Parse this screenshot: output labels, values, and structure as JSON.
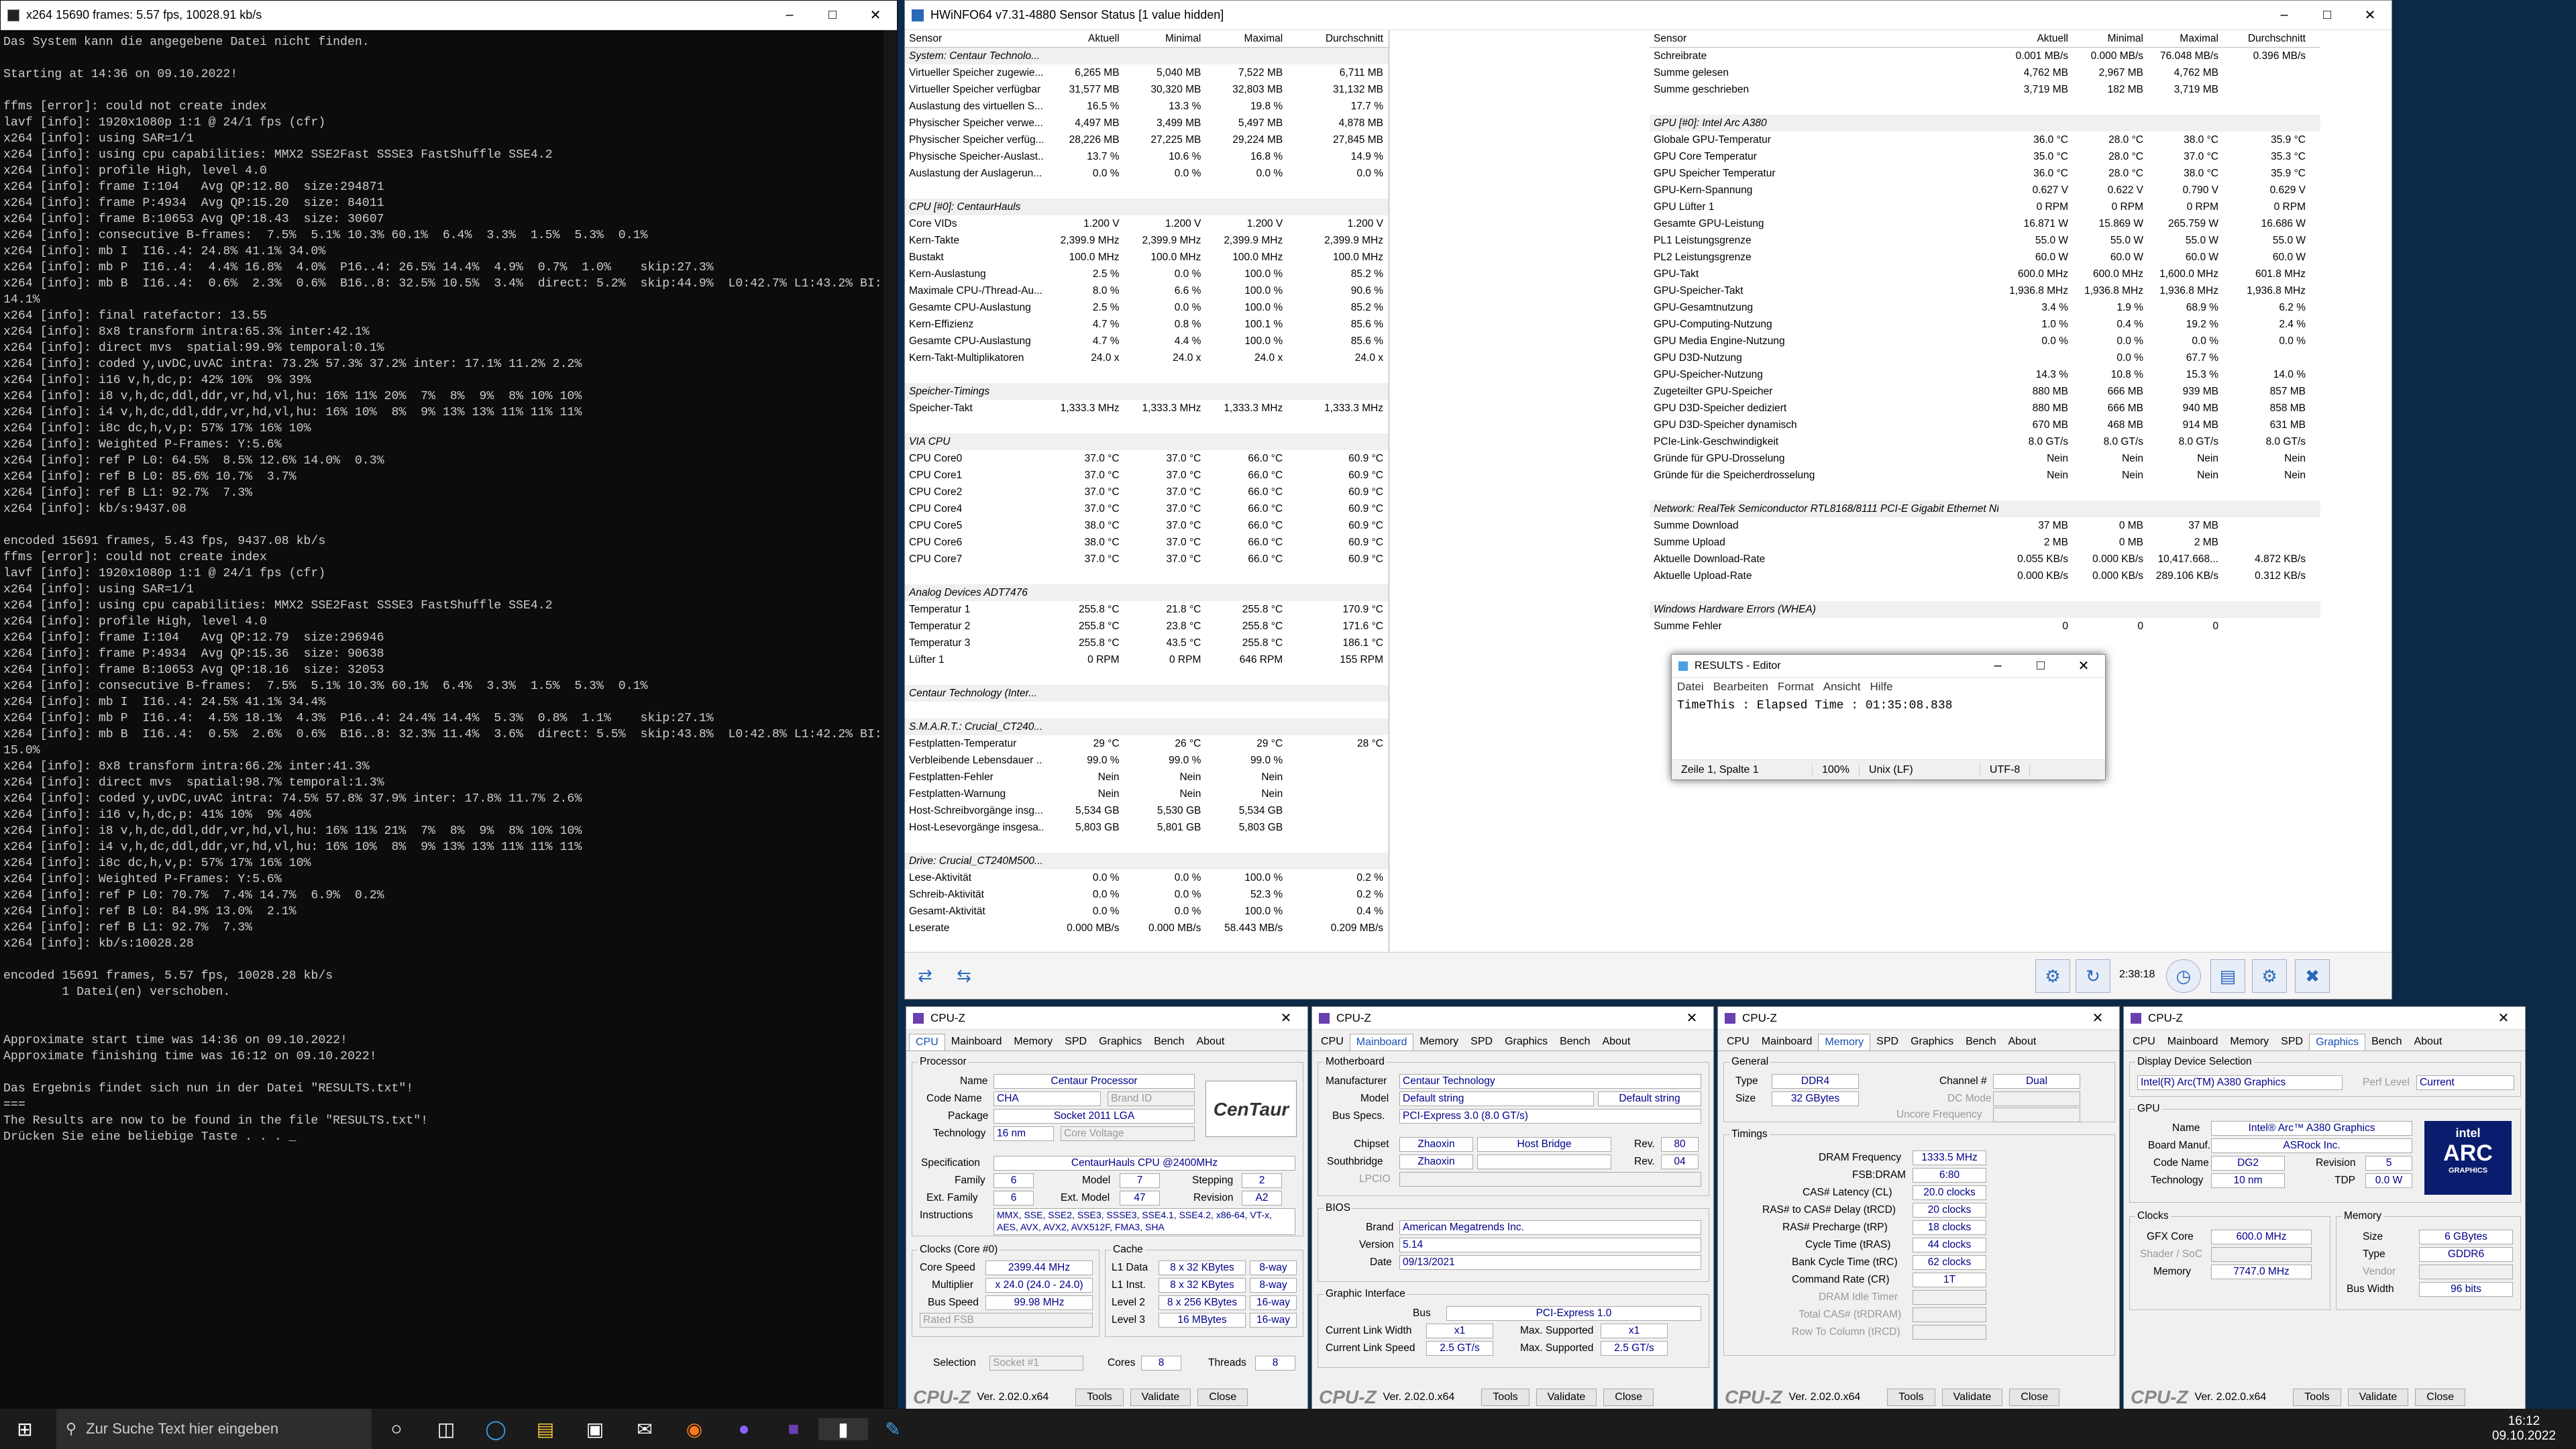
{
  "console": {
    "title": "x264 15690 frames: 5.57 fps, 10028.91 kb/s",
    "lines": [
      "Das System kann die angegebene Datei nicht finden.",
      "",
      "Starting at 14:36 on 09.10.2022!",
      "",
      "ffms [error]: could not create index",
      "lavf [info]: 1920x1080p 1:1 @ 24/1 fps (cfr)",
      "x264 [info]: using SAR=1/1",
      "x264 [info]: using cpu capabilities: MMX2 SSE2Fast SSSE3 FastShuffle SSE4.2",
      "x264 [info]: profile High, level 4.0",
      "x264 [info]: frame I:104   Avg QP:12.80  size:294871",
      "x264 [info]: frame P:4934  Avg QP:15.20  size: 84011",
      "x264 [info]: frame B:10653 Avg QP:18.43  size: 30607",
      "x264 [info]: consecutive B-frames:  7.5%  5.1% 10.3% 60.1%  6.4%  3.3%  1.5%  5.3%  0.1%",
      "x264 [info]: mb I  I16..4: 24.8% 41.1% 34.0%",
      "x264 [info]: mb P  I16..4:  4.4% 16.8%  4.0%  P16..4: 26.5% 14.4%  4.9%  0.7%  1.0%    skip:27.3%",
      "x264 [info]: mb B  I16..4:  0.6%  2.3%  0.6%  B16..8: 32.5% 10.5%  3.4%  direct: 5.2%  skip:44.9%  L0:42.7% L1:43.2% BI:",
      "14.1%",
      "x264 [info]: final ratefactor: 13.55",
      "x264 [info]: 8x8 transform intra:65.3% inter:42.1%",
      "x264 [info]: direct mvs  spatial:99.9% temporal:0.1%",
      "x264 [info]: coded y,uvDC,uvAC intra: 73.2% 57.3% 37.2% inter: 17.1% 11.2% 2.2%",
      "x264 [info]: i16 v,h,dc,p: 42% 10%  9% 39%",
      "x264 [info]: i8 v,h,dc,ddl,ddr,vr,hd,vl,hu: 16% 11% 20%  7%  8%  9%  8% 10% 10%",
      "x264 [info]: i4 v,h,dc,ddl,ddr,vr,hd,vl,hu: 16% 10%  8%  9% 13% 13% 11% 11% 11%",
      "x264 [info]: i8c dc,h,v,p: 57% 17% 16% 10%",
      "x264 [info]: Weighted P-Frames: Y:5.6%",
      "x264 [info]: ref P L0: 64.5%  8.5% 12.6% 14.0%  0.3%",
      "x264 [info]: ref B L0: 85.6% 10.7%  3.7%",
      "x264 [info]: ref B L1: 92.7%  7.3%",
      "x264 [info]: kb/s:9437.08",
      "",
      "encoded 15691 frames, 5.43 fps, 9437.08 kb/s",
      "ffms [error]: could not create index",
      "lavf [info]: 1920x1080p 1:1 @ 24/1 fps (cfr)",
      "x264 [info]: using SAR=1/1",
      "x264 [info]: using cpu capabilities: MMX2 SSE2Fast SSSE3 FastShuffle SSE4.2",
      "x264 [info]: profile High, level 4.0",
      "x264 [info]: frame I:104   Avg QP:12.79  size:296946",
      "x264 [info]: frame P:4934  Avg QP:15.36  size: 90638",
      "x264 [info]: frame B:10653 Avg QP:18.16  size: 32053",
      "x264 [info]: consecutive B-frames:  7.5%  5.1% 10.3% 60.1%  6.4%  3.3%  1.5%  5.3%  0.1%",
      "x264 [info]: mb I  I16..4: 24.5% 41.1% 34.4%",
      "x264 [info]: mb P  I16..4:  4.5% 18.1%  4.3%  P16..4: 24.4% 14.4%  5.3%  0.8%  1.1%    skip:27.1%",
      "x264 [info]: mb B  I16..4:  0.5%  2.6%  0.6%  B16..8: 32.3% 11.4%  3.6%  direct: 5.5%  skip:43.8%  L0:42.8% L1:42.2% BI:",
      "15.0%",
      "x264 [info]: 8x8 transform intra:66.2% inter:41.3%",
      "x264 [info]: direct mvs  spatial:98.7% temporal:1.3%",
      "x264 [info]: coded y,uvDC,uvAC intra: 74.5% 57.8% 37.9% inter: 17.8% 11.7% 2.6%",
      "x264 [info]: i16 v,h,dc,p: 41% 10%  9% 40%",
      "x264 [info]: i8 v,h,dc,ddl,ddr,vr,hd,vl,hu: 16% 11% 21%  7%  8%  9%  8% 10% 10%",
      "x264 [info]: i4 v,h,dc,ddl,ddr,vr,hd,vl,hu: 16% 10%  8%  9% 13% 13% 11% 11% 11%",
      "x264 [info]: i8c dc,h,v,p: 57% 17% 16% 10%",
      "x264 [info]: Weighted P-Frames: Y:5.6%",
      "x264 [info]: ref P L0: 70.7%  7.4% 14.7%  6.9%  0.2%",
      "x264 [info]: ref B L0: 84.9% 13.0%  2.1%",
      "x264 [info]: ref B L1: 92.7%  7.3%",
      "x264 [info]: kb/s:10028.28",
      "",
      "encoded 15691 frames, 5.57 fps, 10028.28 kb/s",
      "        1 Datei(en) verschoben.",
      "",
      "",
      "Approximate start time was 14:36 on 09.10.2022!",
      "Approximate finishing time was 16:12 on 09.10.2022!",
      "",
      "Das Ergebnis findet sich nun in der Datei \"RESULTS.txt\"!",
      "===",
      "The Results are now to be found in the file \"RESULTS.txt\"!",
      "Drücken Sie eine beliebige Taste . . . _"
    ]
  },
  "hwinfo": {
    "title": "HWiNFO64 v7.31-4880 Sensor Status [1 value hidden]",
    "headers": [
      "Sensor",
      "Aktuell",
      "Minimal",
      "Maximal",
      "Durchschnitt"
    ],
    "left": [
      [
        "System: Centaur Technolo...",
        "",
        "",
        "",
        "",
        1
      ],
      [
        "Virtueller Speicher zugewie...",
        "6,265 MB",
        "5,040 MB",
        "7,522 MB",
        "6,711 MB"
      ],
      [
        "Virtueller Speicher verfügbar",
        "31,577 MB",
        "30,320 MB",
        "32,803 MB",
        "31,132 MB"
      ],
      [
        "Auslastung des virtuellen S...",
        "16.5 %",
        "13.3 %",
        "19.8 %",
        "17.7 %"
      ],
      [
        "Physischer Speicher verwe...",
        "4,497 MB",
        "3,499 MB",
        "5,497 MB",
        "4,878 MB"
      ],
      [
        "Physischer Speicher verfüg...",
        "28,226 MB",
        "27,225 MB",
        "29,224 MB",
        "27,845 MB"
      ],
      [
        "Physische Speicher-Auslast...",
        "13.7 %",
        "10.6 %",
        "16.8 %",
        "14.9 %"
      ],
      [
        "Auslastung der Auslagerun...",
        "0.0 %",
        "0.0 %",
        "0.0 %",
        "0.0 %"
      ],
      [
        "",
        "",
        "",
        "",
        ""
      ],
      [
        "CPU [#0]: CentaurHauls",
        "",
        "",
        "",
        "",
        1
      ],
      [
        "Core VIDs",
        "1.200 V",
        "1.200 V",
        "1.200 V",
        "1.200 V"
      ],
      [
        "Kern-Takte",
        "2,399.9 MHz",
        "2,399.9 MHz",
        "2,399.9 MHz",
        "2,399.9 MHz"
      ],
      [
        "Bustakt",
        "100.0 MHz",
        "100.0 MHz",
        "100.0 MHz",
        "100.0 MHz"
      ],
      [
        "Kern-Auslastung",
        "2.5 %",
        "0.0 %",
        "100.0 %",
        "85.2 %"
      ],
      [
        "Maximale CPU-/Thread-Au...",
        "8.0 %",
        "6.6 %",
        "100.0 %",
        "90.6 %"
      ],
      [
        "Gesamte CPU-Auslastung",
        "2.5 %",
        "0.0 %",
        "100.0 %",
        "85.2 %"
      ],
      [
        "Kern-Effizienz",
        "4.7 %",
        "0.8 %",
        "100.1 %",
        "85.6 %"
      ],
      [
        "Gesamte CPU-Auslastung",
        "4.7 %",
        "4.4 %",
        "100.0 %",
        "85.6 %"
      ],
      [
        "Kern-Takt-Multiplikatoren",
        "24.0 x",
        "24.0 x",
        "24.0 x",
        "24.0 x"
      ],
      [
        "",
        "",
        "",
        "",
        ""
      ],
      [
        "Speicher-Timings",
        "",
        "",
        "",
        "",
        1
      ],
      [
        "Speicher-Takt",
        "1,333.3 MHz",
        "1,333.3 MHz",
        "1,333.3 MHz",
        "1,333.3 MHz"
      ],
      [
        "",
        "",
        "",
        "",
        ""
      ],
      [
        "VIA CPU",
        "",
        "",
        "",
        "",
        1
      ],
      [
        "CPU Core0",
        "37.0 °C",
        "37.0 °C",
        "66.0 °C",
        "60.9 °C"
      ],
      [
        "CPU Core1",
        "37.0 °C",
        "37.0 °C",
        "66.0 °C",
        "60.9 °C"
      ],
      [
        "CPU Core2",
        "37.0 °C",
        "37.0 °C",
        "66.0 °C",
        "60.9 °C"
      ],
      [
        "CPU Core4",
        "37.0 °C",
        "37.0 °C",
        "66.0 °C",
        "60.9 °C"
      ],
      [
        "CPU Core5",
        "38.0 °C",
        "37.0 °C",
        "66.0 °C",
        "60.9 °C"
      ],
      [
        "CPU Core6",
        "38.0 °C",
        "37.0 °C",
        "66.0 °C",
        "60.9 °C"
      ],
      [
        "CPU Core7",
        "37.0 °C",
        "37.0 °C",
        "66.0 °C",
        "60.9 °C"
      ],
      [
        "",
        "",
        "",
        "",
        ""
      ],
      [
        "Analog Devices ADT7476",
        "",
        "",
        "",
        "",
        1
      ],
      [
        "Temperatur 1",
        "255.8 °C",
        "21.8 °C",
        "255.8 °C",
        "170.9 °C"
      ],
      [
        "Temperatur 2",
        "255.8 °C",
        "23.8 °C",
        "255.8 °C",
        "171.6 °C"
      ],
      [
        "Temperatur 3",
        "255.8 °C",
        "43.5 °C",
        "255.8 °C",
        "186.1 °C"
      ],
      [
        "Lüfter 1",
        "0 RPM",
        "0 RPM",
        "646 RPM",
        "155 RPM"
      ],
      [
        "",
        "",
        "",
        "",
        ""
      ],
      [
        "Centaur Technology (Inter...",
        "",
        "",
        "",
        "",
        1
      ],
      [
        "",
        "",
        "",
        "",
        ""
      ],
      [
        "S.M.A.R.T.: Crucial_CT240...",
        "",
        "",
        "",
        "",
        1
      ],
      [
        "Festplatten-Temperatur",
        "29 °C",
        "26 °C",
        "29 °C",
        "28 °C"
      ],
      [
        "Verbleibende Lebensdauer ...",
        "99.0 %",
        "99.0 %",
        "99.0 %",
        ""
      ],
      [
        "Festplatten-Fehler",
        "Nein",
        "Nein",
        "Nein",
        ""
      ],
      [
        "Festplatten-Warnung",
        "Nein",
        "Nein",
        "Nein",
        ""
      ],
      [
        "Host-Schreibvorgänge insg...",
        "5,534 GB",
        "5,530 GB",
        "5,534 GB",
        ""
      ],
      [
        "Host-Lesevorgänge insgesa...",
        "5,803 GB",
        "5,801 GB",
        "5,803 GB",
        ""
      ],
      [
        "",
        "",
        "",
        "",
        ""
      ],
      [
        "Drive: Crucial_CT240M500...",
        "",
        "",
        "",
        "",
        1
      ],
      [
        "Lese-Aktivität",
        "0.0 %",
        "0.0 %",
        "100.0 %",
        "0.2 %"
      ],
      [
        "Schreib-Aktivität",
        "0.0 %",
        "0.0 %",
        "52.3 %",
        "0.2 %"
      ],
      [
        "Gesamt-Aktivität",
        "0.0 %",
        "0.0 %",
        "100.0 %",
        "0.4 %"
      ],
      [
        "Leserate",
        "0.000 MB/s",
        "0.000 MB/s",
        "58.443 MB/s",
        "0.209 MB/s"
      ]
    ],
    "right": [
      [
        "Schreibrate",
        "0.001 MB/s",
        "0.000 MB/s",
        "76.048 MB/s",
        "0.396 MB/s"
      ],
      [
        "Summe gelesen",
        "4,762 MB",
        "2,967 MB",
        "4,762 MB",
        ""
      ],
      [
        "Summe geschrieben",
        "3,719 MB",
        "182 MB",
        "3,719 MB",
        ""
      ],
      [
        "",
        "",
        "",
        "",
        ""
      ],
      [
        "GPU [#0]: Intel Arc A380",
        "",
        "",
        "",
        "",
        1
      ],
      [
        "Globale GPU-Temperatur",
        "36.0 °C",
        "28.0 °C",
        "38.0 °C",
        "35.9 °C"
      ],
      [
        "GPU Core Temperatur",
        "35.0 °C",
        "28.0 °C",
        "37.0 °C",
        "35.3 °C"
      ],
      [
        "GPU Speicher Temperatur",
        "36.0 °C",
        "28.0 °C",
        "38.0 °C",
        "35.9 °C"
      ],
      [
        "GPU-Kern-Spannung",
        "0.627 V",
        "0.622 V",
        "0.790 V",
        "0.629 V"
      ],
      [
        "GPU Lüfter 1",
        "0 RPM",
        "0 RPM",
        "0 RPM",
        "0 RPM"
      ],
      [
        "Gesamte GPU-Leistung",
        "16.871 W",
        "15.869 W",
        "265.759 W",
        "16.686 W"
      ],
      [
        "PL1 Leistungsgrenze",
        "55.0 W",
        "55.0 W",
        "55.0 W",
        "55.0 W"
      ],
      [
        "PL2 Leistungsgrenze",
        "60.0 W",
        "60.0 W",
        "60.0 W",
        "60.0 W"
      ],
      [
        "GPU-Takt",
        "600.0 MHz",
        "600.0 MHz",
        "1,600.0 MHz",
        "601.8 MHz"
      ],
      [
        "GPU-Speicher-Takt",
        "1,936.8 MHz",
        "1,936.8 MHz",
        "1,936.8 MHz",
        "1,936.8 MHz"
      ],
      [
        "GPU-Gesamtnutzung",
        "3.4 %",
        "1.9 %",
        "68.9 %",
        "6.2 %"
      ],
      [
        "GPU-Computing-Nutzung",
        "1.0 %",
        "0.4 %",
        "19.2 %",
        "2.4 %"
      ],
      [
        "GPU Media Engine-Nutzung",
        "0.0 %",
        "0.0 %",
        "0.0 %",
        "0.0 %"
      ],
      [
        "GPU D3D-Nutzung",
        "",
        "0.0 %",
        "67.7 %",
        ""
      ],
      [
        "GPU-Speicher-Nutzung",
        "14.3 %",
        "10.8 %",
        "15.3 %",
        "14.0 %"
      ],
      [
        "Zugeteilter GPU-Speicher",
        "880 MB",
        "666 MB",
        "939 MB",
        "857 MB"
      ],
      [
        "GPU D3D-Speicher dediziert",
        "880 MB",
        "666 MB",
        "940 MB",
        "858 MB"
      ],
      [
        "GPU D3D-Speicher dynamisch",
        "670 MB",
        "468 MB",
        "914 MB",
        "631 MB"
      ],
      [
        "PCIe-Link-Geschwindigkeit",
        "8.0 GT/s",
        "8.0 GT/s",
        "8.0 GT/s",
        "8.0 GT/s"
      ],
      [
        "Gründe für GPU-Drosselung",
        "Nein",
        "Nein",
        "Nein",
        "Nein"
      ],
      [
        "Gründe für die Speicherdrosselung",
        "Nein",
        "Nein",
        "Nein",
        "Nein"
      ],
      [
        "",
        "",
        "",
        "",
        ""
      ],
      [
        "Network: RealTek Semiconductor RTL8168/8111 PCI-E Gigabit Ethernet NIC",
        "",
        "",
        "",
        "",
        1
      ],
      [
        "Summe Download",
        "37 MB",
        "0 MB",
        "37 MB",
        ""
      ],
      [
        "Summe Upload",
        "2 MB",
        "0 MB",
        "2 MB",
        ""
      ],
      [
        "Aktuelle Download-Rate",
        "0.055 KB/s",
        "0.000 KB/s",
        "10,417.668...",
        "4.872 KB/s"
      ],
      [
        "Aktuelle Upload-Rate",
        "0.000 KB/s",
        "0.000 KB/s",
        "289.106 KB/s",
        "0.312 KB/s"
      ],
      [
        "",
        "",
        "",
        "",
        ""
      ],
      [
        "Windows Hardware Errors (WHEA)",
        "",
        "",
        "",
        "",
        1
      ],
      [
        "Summe Fehler",
        "0",
        "0",
        "0",
        ""
      ]
    ],
    "time": "2:38:18"
  },
  "editor": {
    "title": "RESULTS - Editor",
    "menu": [
      "Datei",
      "Bearbeiten",
      "Format",
      "Ansicht",
      "Hilfe"
    ],
    "text": "TimeThis :  Elapsed Time :  01:35:08.838",
    "status": [
      "Zeile 1, Spalte 1",
      "100%",
      "Unix (LF)",
      "UTF-8"
    ]
  },
  "cpuz": {
    "title": "CPU-Z",
    "version": "Ver. 2.02.0.x64",
    "tools": "Tools",
    "validate": "Validate",
    "close": "Close",
    "tabs": [
      "CPU",
      "Mainboard",
      "Memory",
      "SPD",
      "Graphics",
      "Bench",
      "About"
    ],
    "cpu": {
      "name": "Centaur Processor",
      "codename": "CHA",
      "brandid": "Brand ID",
      "package": "Socket 2011 LGA",
      "tech": "16 nm",
      "voltage": "Core Voltage",
      "spec": "CentaurHauls CPU @2400MHz",
      "family": "6",
      "model": "7",
      "stepping": "2",
      "extfamily": "6",
      "extmodel": "47",
      "revision": "A2",
      "instr": "MMX, SSE, SSE2, SSE3, SSSE3, SSE4.1, SSE4.2, x86-64, VT-x, AES, AVX, AVX2, AVX512F, FMA3, SHA",
      "corespeed": "2399.44 MHz",
      "mult": "x 24.0 (24.0 - 24.0)",
      "bus": "99.98 MHz",
      "fsb": "Rated FSB",
      "l1d": "8 x 32 KBytes",
      "l1dw": "8-way",
      "l1i": "8 x 32 KBytes",
      "l1iw": "8-way",
      "l2": "8 x 256 KBytes",
      "l2w": "16-way",
      "l3": "16 MBytes",
      "l3w": "16-way",
      "sel": "Socket #1",
      "cores": "8",
      "threads": "8",
      "logo": "CenTaur"
    },
    "mb": {
      "manu": "Centaur Technology",
      "model": "Default string",
      "model2": "Default string",
      "busspecs": "PCI-Express 3.0 (8.0 GT/s)",
      "chipset": "Zhaoxin",
      "chipset2": "Host Bridge",
      "rev1": "80",
      "south": "Zhaoxin",
      "rev2": "04",
      "lpcio": "LPCIO",
      "brand": "American Megatrends Inc.",
      "version": "5.14",
      "date": "09/13/2021",
      "gbus": "PCI-Express 1.0",
      "width": "x1",
      "maxw": "x1",
      "speed": "2.5 GT/s",
      "maxs": "2.5 GT/s"
    },
    "mem": {
      "type": "DDR4",
      "channel": "Dual",
      "size": "32 GBytes",
      "dram": "1333.5 MHz",
      "fsbdram": "6:80",
      "cas": "20.0 clocks",
      "rcd": "20 clocks",
      "rp": "18 clocks",
      "ras": "44 clocks",
      "rc": "62 clocks",
      "cr": "1T",
      "dcmode": "DC Mode",
      "unc": "Uncore Frequency",
      "idle": "DRAM Idle Timer",
      "tcas": "Total CAS# (tRDRAM)",
      "rtc": "Row To Column (tRCD)"
    },
    "gfx": {
      "device": "Intel(R) Arc(TM) A380 Graphics",
      "perf": "Current",
      "name": "Intel® Arc™ A380 Graphics",
      "board": "ASRock Inc.",
      "code": "DG2",
      "rev": "5",
      "tech": "10 nm",
      "tdp": "0.0 W",
      "gpuclk": "600.0 MHz",
      "shader": "Shader / SoC",
      "memclk": "7747.0 MHz",
      "msize": "6 GBytes",
      "mtype": "GDDR6",
      "vendor": "Vendor",
      "bus": "96 bits"
    }
  },
  "taskbar": {
    "search": "Zur Suche Text hier eingeben",
    "time": "16:12",
    "date": "09.10.2022"
  }
}
